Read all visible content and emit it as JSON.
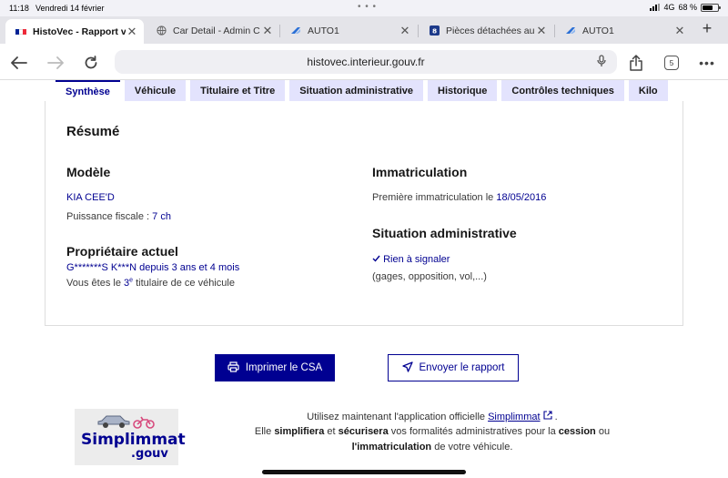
{
  "status": {
    "time": "11:18",
    "date": "Vendredi 14 février",
    "network": "4G",
    "battery": "68 %",
    "battery_level": 0.68
  },
  "browser": {
    "tabs": [
      {
        "title": "HistoVec - Rapport v",
        "favicon": "french-flag-icon",
        "active": true
      },
      {
        "title": "Car Detail - Admin C",
        "favicon": "globe-icon",
        "active": false
      },
      {
        "title": "AUTO1",
        "favicon": "auto1-logo-icon",
        "active": false
      },
      {
        "title": "Pièces détachées au",
        "favicon": "parts-shop-icon",
        "active": false
      },
      {
        "title": "AUTO1",
        "favicon": "auto1-logo-icon",
        "active": false
      }
    ],
    "url": "histovec.interieur.gouv.fr",
    "tab_count": "5"
  },
  "content_tabs": [
    {
      "label": "Synthèse",
      "active": true
    },
    {
      "label": "Véhicule"
    },
    {
      "label": "Titulaire et Titre"
    },
    {
      "label": "Situation administrative"
    },
    {
      "label": "Historique"
    },
    {
      "label": "Contrôles techniques"
    },
    {
      "label": "Kilo"
    }
  ],
  "summary": {
    "title": "Résumé",
    "model": {
      "heading": "Modèle",
      "name": "KIA CEE'D",
      "fiscal_power_label": "Puissance fiscale :",
      "fiscal_power_value": "7 ch"
    },
    "owner": {
      "heading": "Propriétaire actuel",
      "name": "G*******S K***N",
      "since_label": "depuis",
      "since_value": "3 ans et 4 mois",
      "rank_prefix": "Vous êtes le",
      "rank_number": "3",
      "rank_suffix": "e",
      "rank_after": "titulaire de ce véhicule"
    },
    "registration": {
      "heading": "Immatriculation",
      "first_label": "Première immatriculation le",
      "first_date": "18/05/2016"
    },
    "admin": {
      "heading": "Situation administrative",
      "status": "Rien à signaler",
      "details": "(gages, opposition, vol,...)"
    }
  },
  "actions": {
    "print_label": "Imprimer le CSA",
    "send_label": "Envoyer le rapport"
  },
  "simplimmat": {
    "logo_word": "Simplimmat",
    "logo_domain": ".gouv",
    "line1_prefix": "Utilisez maintenant l'application officielle",
    "line1_link": "Simplimmat",
    "line1_suffix": ".",
    "line2_a": "Elle",
    "line2_b": "simplifiera",
    "line2_c": "et",
    "line2_d": "sécurisera",
    "line2_e": "vos formalités administratives pour la",
    "line2_f": "cession",
    "line2_g": "ou",
    "line3_a": "l'immatriculation",
    "line3_b": "de votre véhicule."
  },
  "colors": {
    "primary": "#000091",
    "tab_bg": "#e3e3fd"
  }
}
